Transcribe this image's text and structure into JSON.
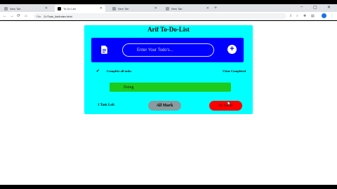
{
  "browser": {
    "tabs": [
      {
        "label": "New Tab",
        "active": false
      },
      {
        "label": "To Do List",
        "active": true
      },
      {
        "label": "New Tab",
        "active": false
      },
      {
        "label": "New Tab",
        "active": false
      }
    ],
    "new_tab_symbol": "+",
    "window_controls": {
      "minimize": "–",
      "maximize": "▢",
      "close": "✕"
    },
    "nav": {
      "back": "←",
      "forward": "→",
      "reload": "⟳",
      "home": "⌂"
    },
    "address": {
      "label": "File",
      "url": "D:/Todo_list/index.html"
    }
  },
  "app": {
    "title": "Arif To-Do-List",
    "input": {
      "placeholder": "Enter Your Todo's..."
    },
    "add_button_label": "+",
    "complete_all_label": "Complete all tasks",
    "clear_completed_label": "Clear Completed",
    "tasks": [
      {
        "text": "Dsing"
      }
    ],
    "footer": {
      "tasks_left": "1 Task Left",
      "all_mark_label": "All Mark",
      "delete_label": "All Delete"
    }
  },
  "colors": {
    "app_background": "#00ffff",
    "input_bar": "#0000ff",
    "task_item": "#1ccb1c",
    "all_mark_button": "#8a9a9e",
    "delete_button": "#ff0000"
  },
  "icons": {
    "document": "document-icon",
    "add": "plus-icon",
    "complete_all": "check-double-icon",
    "cursor": "mouse-cursor-icon"
  }
}
